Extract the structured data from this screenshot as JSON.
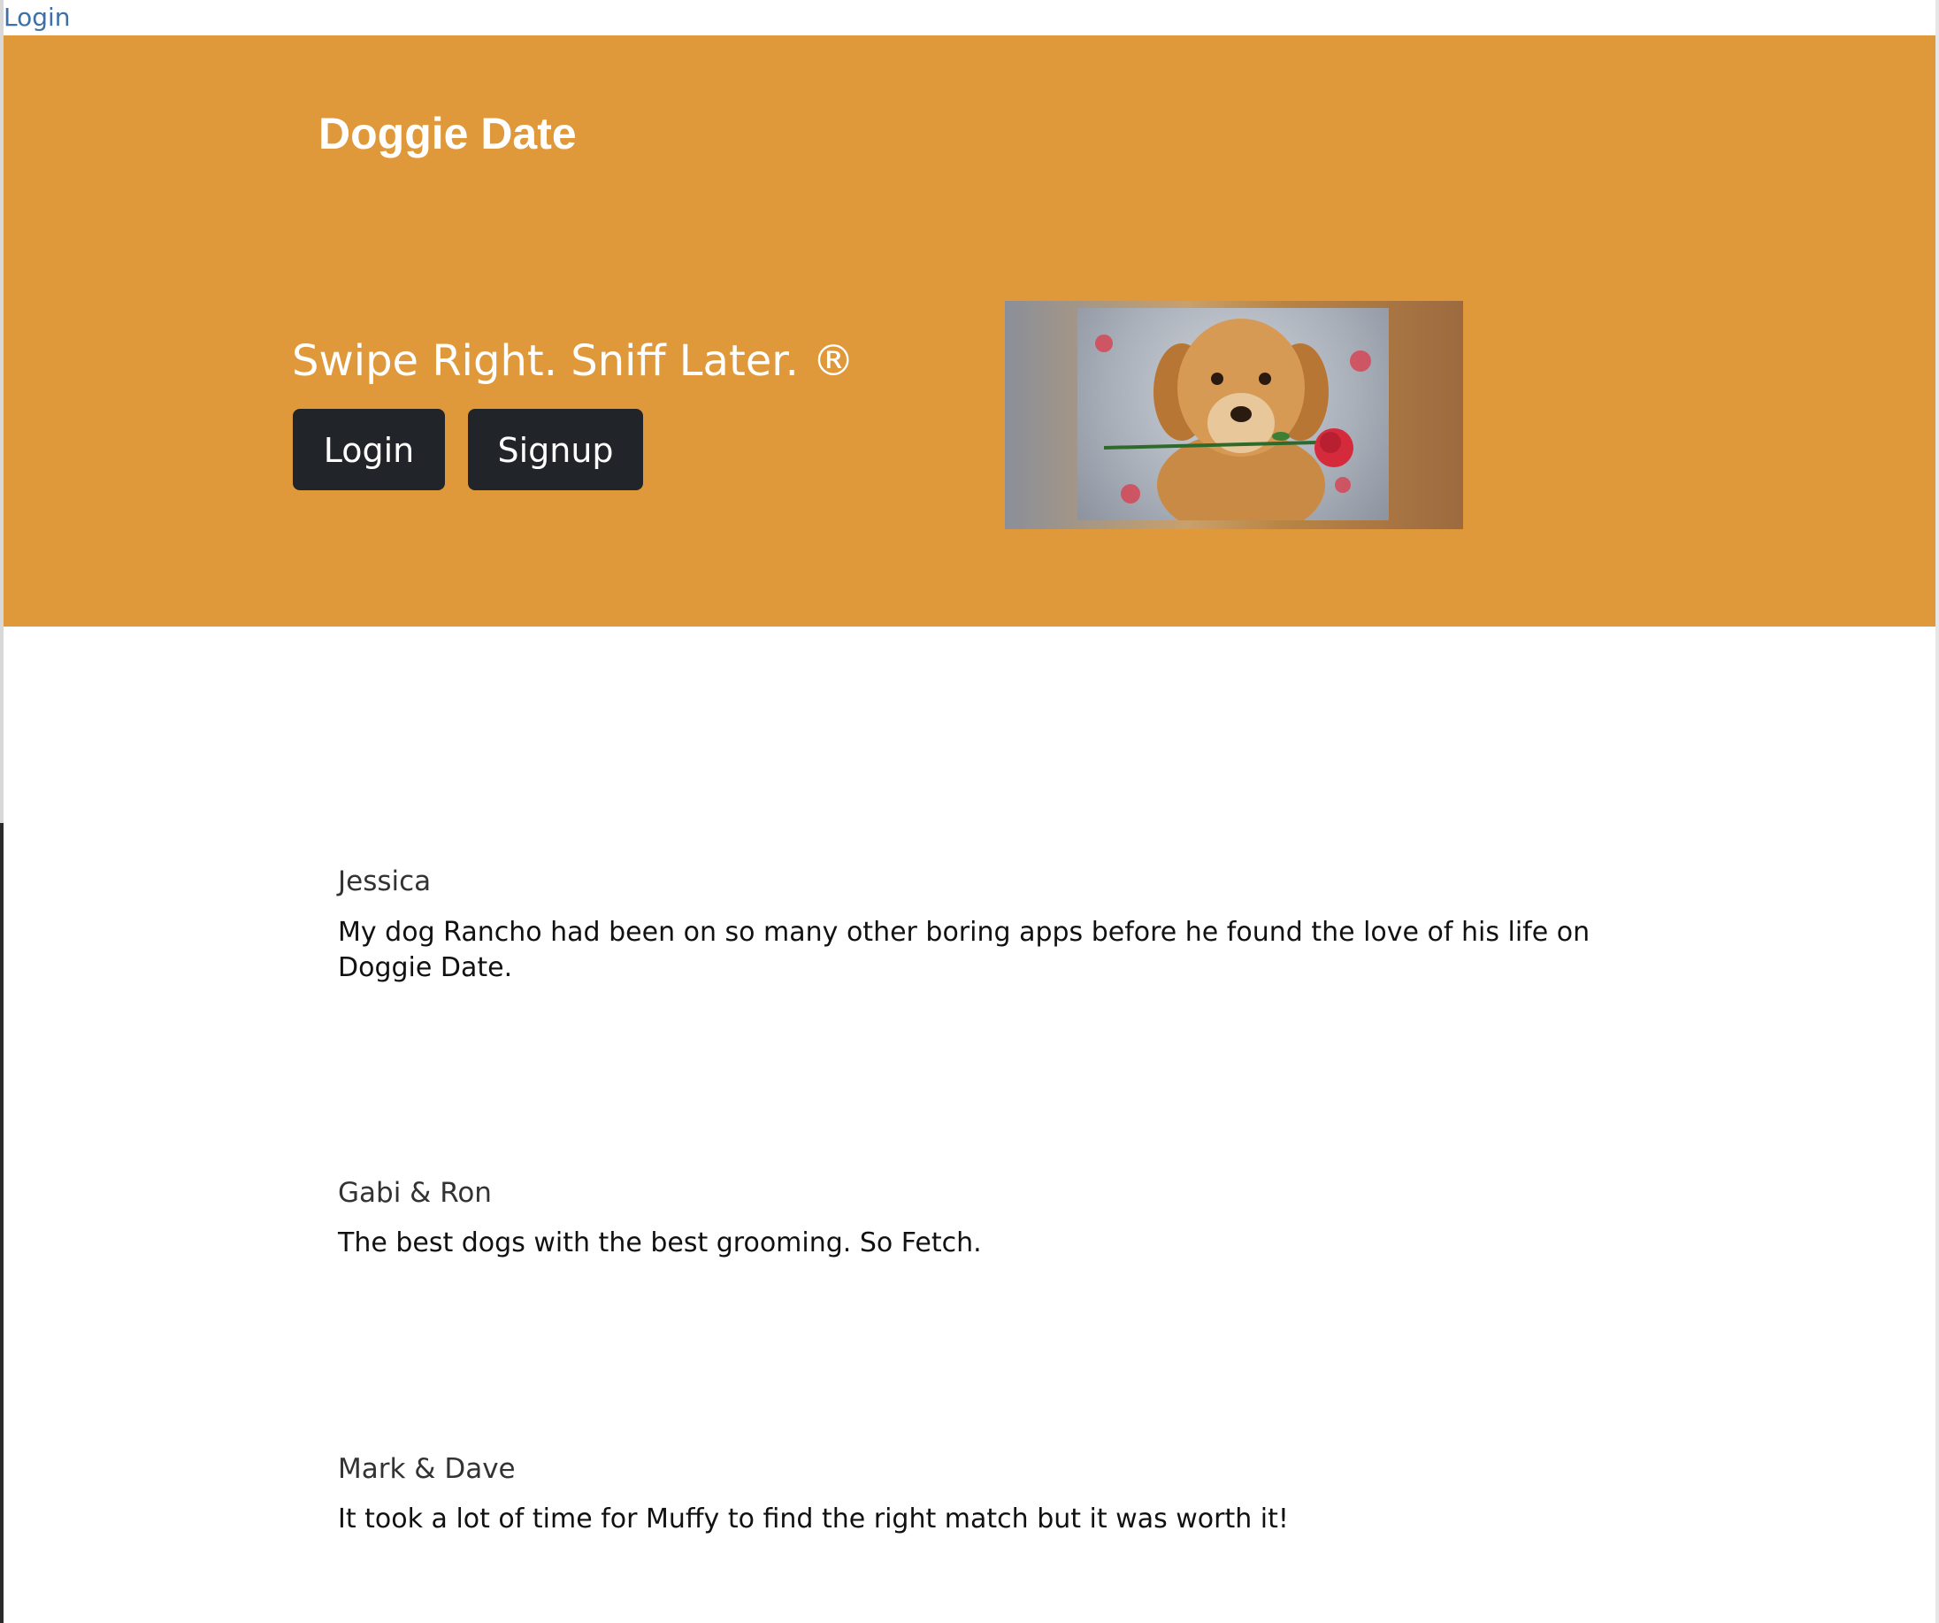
{
  "top_nav": {
    "login_link": "Login"
  },
  "hero": {
    "brand": "Doggie Date",
    "tagline": "Swipe Right. Sniff Later. ®",
    "login_button": "Login",
    "signup_button": "Signup",
    "background_color": "#df983a"
  },
  "testimonials": [
    {
      "name": "Jessica",
      "text": "My dog Rancho had been on so many other boring apps before he found the love of his life on Doggie Date."
    },
    {
      "name": "Gabi & Ron",
      "text": "The best dogs with the best grooming. So Fetch."
    },
    {
      "name": "Mark & Dave",
      "text": "It took a lot of time for Muffy to find the right match but it was worth it!"
    }
  ]
}
